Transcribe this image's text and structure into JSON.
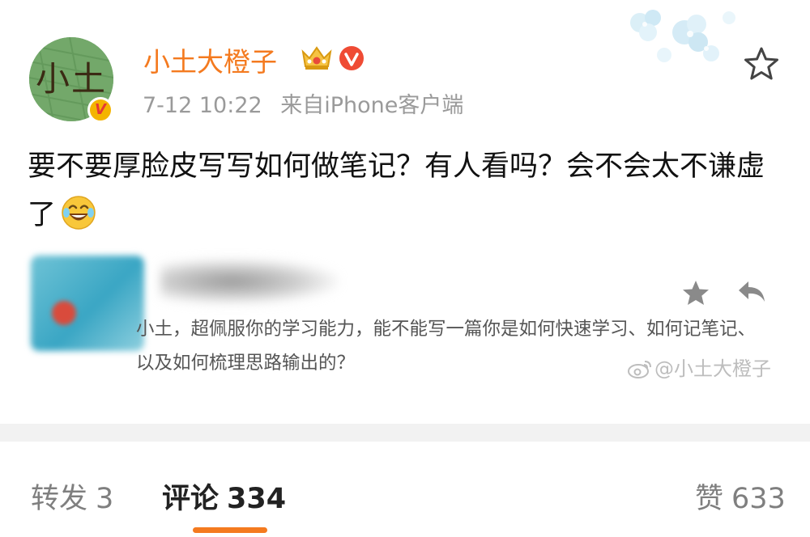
{
  "post": {
    "author": {
      "name": "小土大橙子",
      "avatar_text": "小土",
      "verified_mark": "V",
      "badges": [
        "crown-icon",
        "red-v-icon"
      ]
    },
    "time": "7-12 10:22",
    "source": "来自iPhone客户端",
    "text": "要不要厚脸皮写写如何做笔记？有人看吗？会不会太不谦虚了",
    "emoji": "laugh-cry-emoji"
  },
  "quote": {
    "text": "小土，超佩服你的学习能力，能不能写一篇你是如何快速学习、如何记笔记、以及如何梳理思路输出的？",
    "watermark": "@小土大橙子"
  },
  "stats": {
    "repost_label": "转发",
    "repost_count": "3",
    "comment_label": "评论",
    "comment_count": "334",
    "like_label": "赞",
    "like_count": "633"
  },
  "colors": {
    "accent": "#f47a1f",
    "meta_text": "#9a9a9a",
    "divider": "#f2f2f2"
  }
}
